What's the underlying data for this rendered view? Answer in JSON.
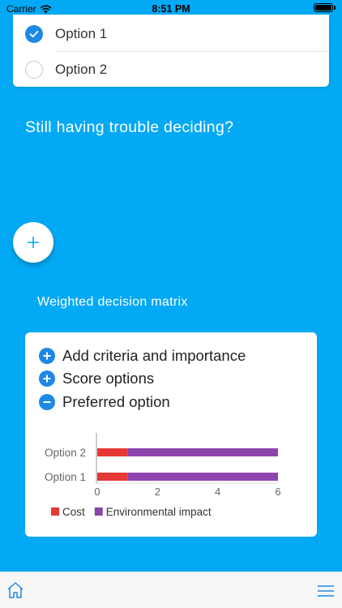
{
  "status_bar": {
    "carrier": "Carrier",
    "time": "8:51 PM"
  },
  "options": [
    {
      "label": "Option 1",
      "selected": true
    },
    {
      "label": "Option 2",
      "selected": false
    }
  ],
  "question": "Still having trouble deciding?",
  "add_button": {
    "icon": "plus-icon"
  },
  "matrix": {
    "title": "Weighted decision matrix",
    "steps": [
      {
        "label": "Add criteria and importance",
        "icon": "plus-circle-icon"
      },
      {
        "label": "Score options",
        "icon": "plus-circle-icon"
      },
      {
        "label": "Preferred option",
        "icon": "minus-circle-icon"
      }
    ]
  },
  "chart_data": {
    "type": "bar",
    "orientation": "horizontal",
    "stacked": true,
    "categories": [
      "Option 2",
      "Option 1"
    ],
    "series": [
      {
        "name": "Cost",
        "color": "#e53935",
        "values": [
          1,
          1
        ]
      },
      {
        "name": "Environmental impact",
        "color": "#8e44ad",
        "values": [
          5,
          5
        ]
      }
    ],
    "xticks": [
      "0",
      "2",
      "4",
      "6"
    ],
    "xlim": [
      0,
      6
    ],
    "legend_position": "bottom"
  },
  "colors": {
    "background": "#03a9f4",
    "accent": "#1e88e5"
  },
  "nav": {
    "home_icon": "home-icon",
    "menu_icon": "hamburger-menu-icon"
  }
}
